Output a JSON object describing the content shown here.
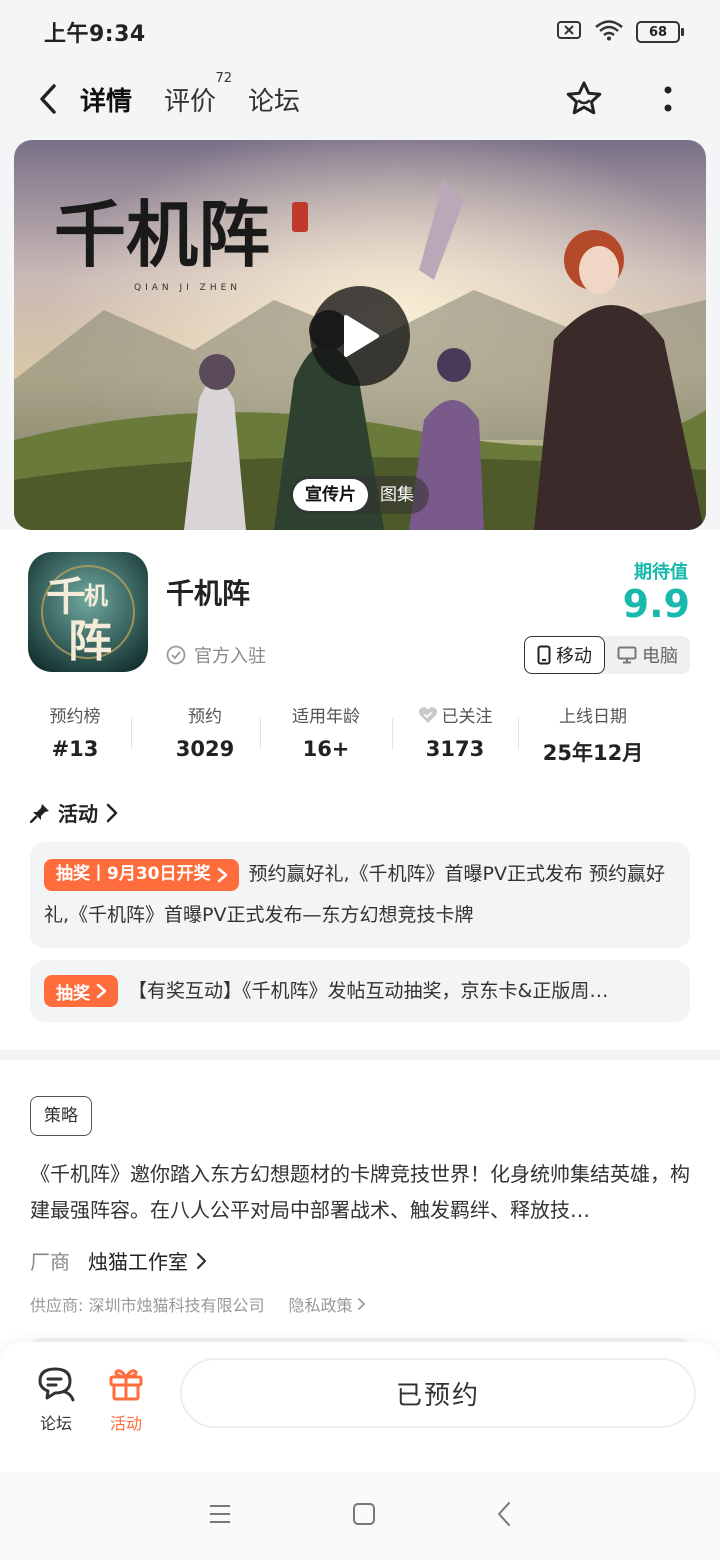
{
  "status": {
    "time": "上午9:34",
    "battery": "68"
  },
  "nav": {
    "tabs": [
      {
        "label": "详情"
      },
      {
        "label": "评价",
        "badge": "72"
      },
      {
        "label": "论坛"
      }
    ]
  },
  "banner": {
    "tabs": [
      "宣传片",
      "图集"
    ]
  },
  "app": {
    "name": "千机阵",
    "official": "官方入驻",
    "expect_label": "期待值",
    "expect_value": "9.9",
    "platforms": [
      "移动",
      "电脑"
    ]
  },
  "stats": [
    {
      "label": "预约榜",
      "value": "#13"
    },
    {
      "label": "预约",
      "value": "3029"
    },
    {
      "label": "适用年龄",
      "value": "16+"
    },
    {
      "label": "已关注",
      "value": "3173"
    },
    {
      "label": "上线日期",
      "value": "25年12月"
    }
  ],
  "activity": {
    "title": "活动",
    "items": [
      {
        "badge": "抽奖丨9月30日开奖",
        "text": "预约赢好礼,《千机阵》首曝PV正式发布 预约赢好礼,《千机阵》首曝PV正式发布—东方幻想竞技卡牌"
      },
      {
        "badge": "抽奖",
        "text": "【有奖互动】《千机阵》发帖互动抽奖，京东卡&正版周…"
      }
    ]
  },
  "info": {
    "tag": "策略",
    "description": "《千机阵》邀你踏入东方幻想题材的卡牌竞技世界！化身统帅集结英雄，构建最强阵容。在八人公平对局中部署战术、触发羁绊、释放技…",
    "vendor_label": "厂商",
    "vendor_name": "烛猫工作室",
    "supplier": "供应商: 深圳市烛猫科技有限公司",
    "privacy": "隐私政策"
  },
  "bottom": {
    "forum": "论坛",
    "activity": "活动",
    "reserve": "已预约"
  },
  "colors": {
    "accent": "#16b9ab",
    "orange": "#ff6d3c"
  }
}
